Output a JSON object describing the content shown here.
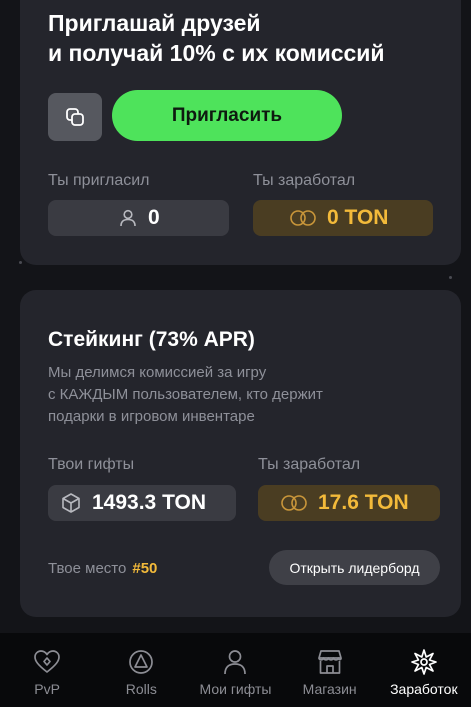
{
  "invite": {
    "title_line1": "Приглашай друзей",
    "title_line2": "и получай 10% с их комиссий",
    "invite_button": "Пригласить",
    "invited_label": "Ты пригласил",
    "invited_count": "0",
    "earned_label": "Ты заработал",
    "earned_value": "0 TON"
  },
  "staking": {
    "title": "Стейкинг (73% APR)",
    "desc_line1": "Мы делимся комиссией за игру",
    "desc_line2": "с КАЖДЫМ пользователем, кто держит",
    "desc_line3": "подарки в игровом инвентаре",
    "gifts_label": "Твои гифты",
    "gifts_value": "1493.3 TON",
    "earned_label": "Ты заработал",
    "earned_value": "17.6 TON",
    "place_label": "Твое место",
    "place_value": "#50",
    "leaderboard_button": "Открыть лидерборд"
  },
  "tabs": [
    {
      "label": "PvP",
      "icon": "heart-icon",
      "active": false
    },
    {
      "label": "Rolls",
      "icon": "pyramid-icon",
      "active": false
    },
    {
      "label": "Мои гифты",
      "icon": "person-icon",
      "active": false
    },
    {
      "label": "Магазин",
      "icon": "store-icon",
      "active": false
    },
    {
      "label": "Заработок",
      "icon": "burst-icon",
      "active": true
    }
  ],
  "colors": {
    "background": "#131418",
    "card": "#24252c",
    "accent_green": "#4ee35b",
    "gold": "#f3ba3a",
    "gold_bg": "#4a3d22"
  }
}
